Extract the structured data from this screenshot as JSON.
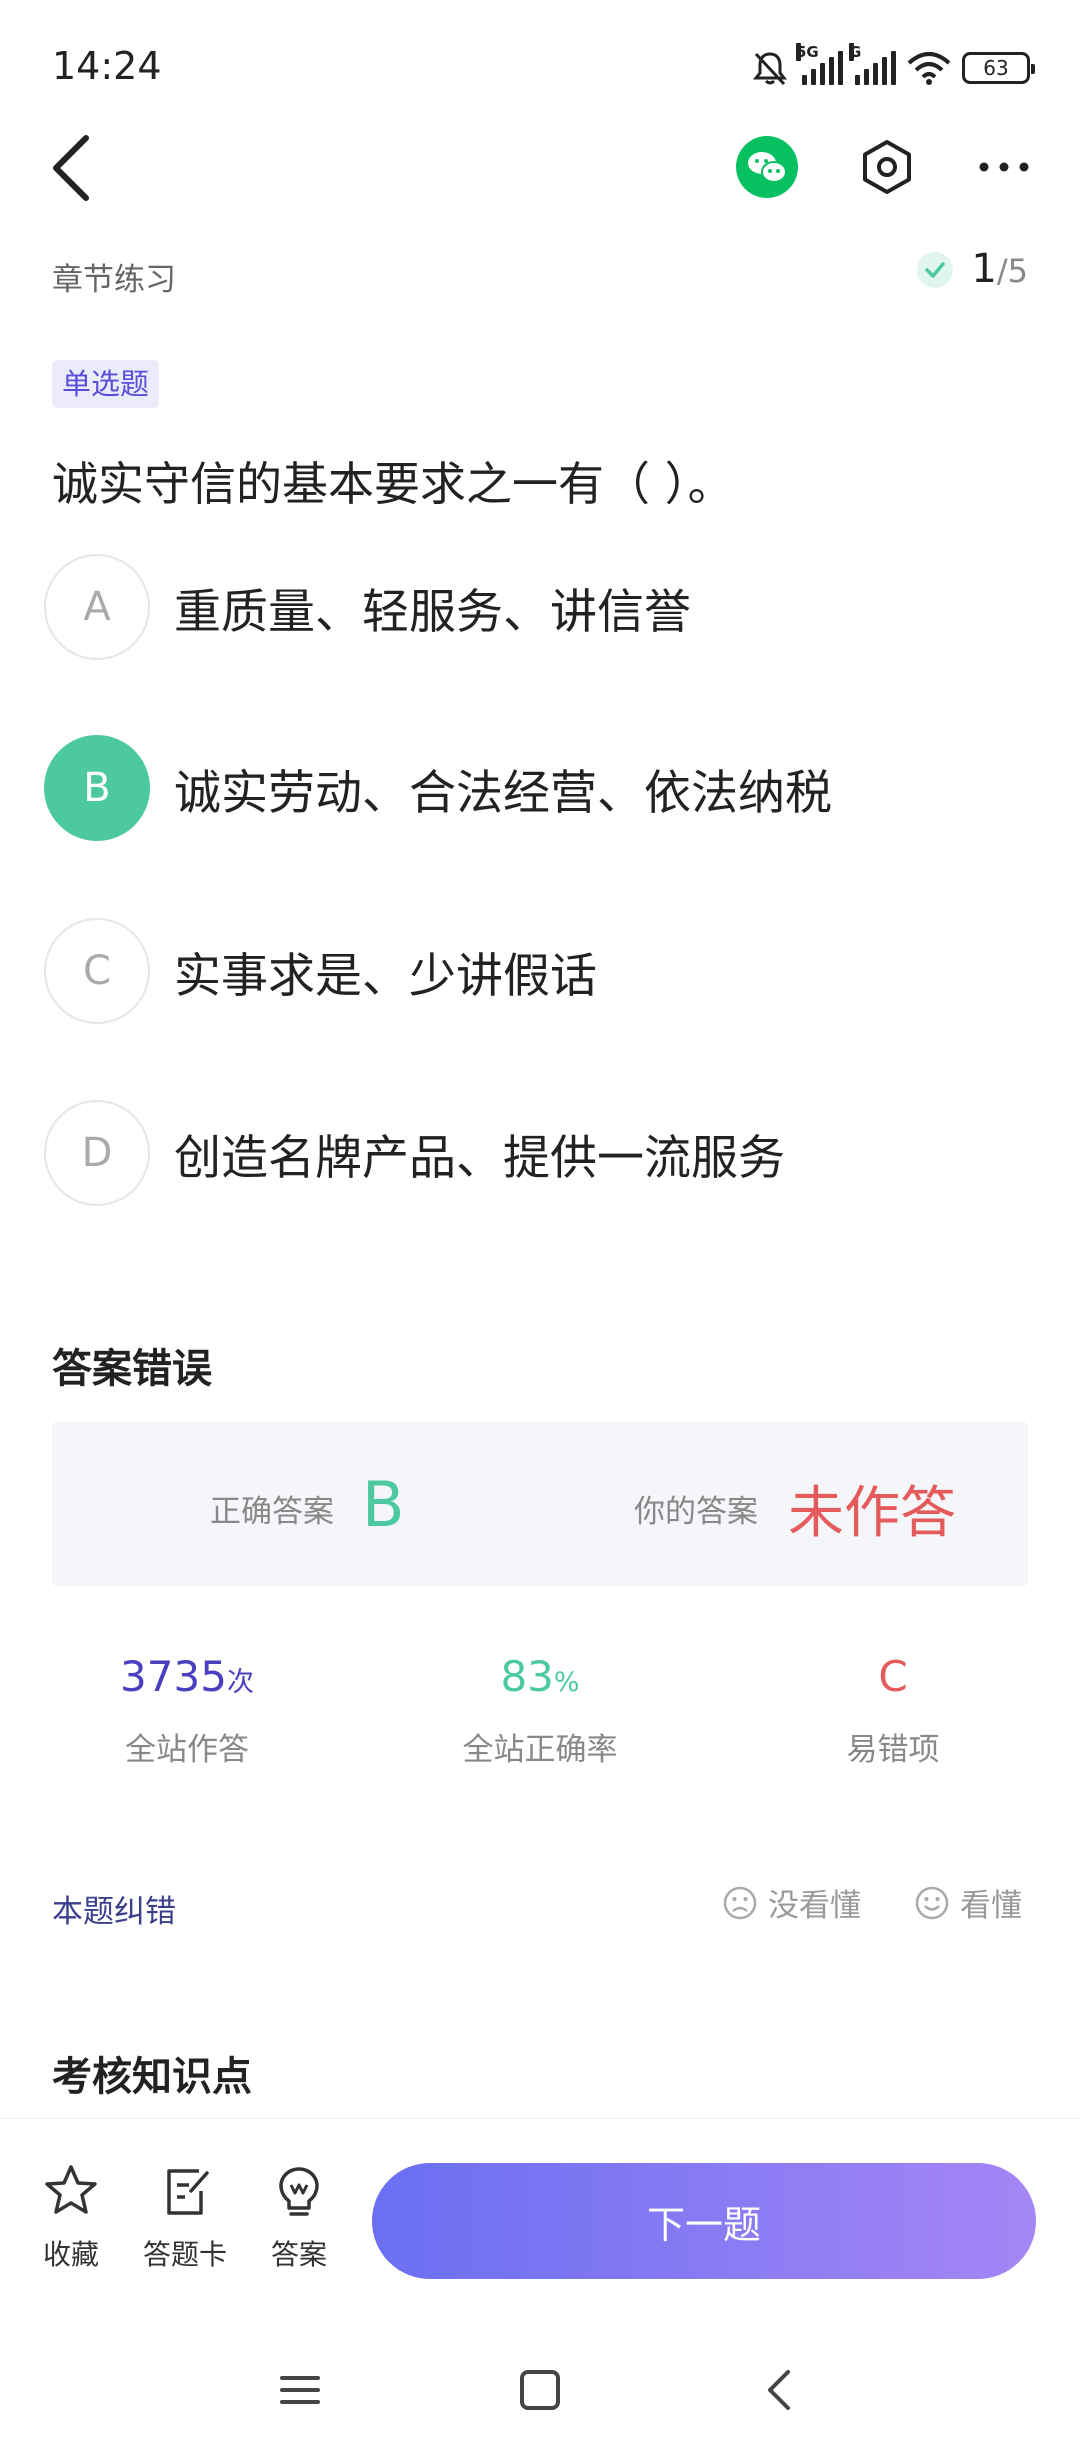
{
  "status_bar": {
    "time": "14:24",
    "signal1_tag": "5G",
    "signal2_tag": "G",
    "battery": "63",
    "icons": [
      "bell-off-icon",
      "signal-icon",
      "wifi-icon",
      "battery-icon"
    ]
  },
  "header": {
    "icons": [
      "back-icon",
      "wechat-icon",
      "settings-icon",
      "more-icon"
    ],
    "section": "章节练习",
    "progress": {
      "current": "1",
      "separator": "/",
      "total": "5"
    }
  },
  "question": {
    "type": "单选题",
    "text": "诚实守信的基本要求之一有（ ）。",
    "options": [
      {
        "letter": "A",
        "text": "重质量、轻服务、讲信誉"
      },
      {
        "letter": "B",
        "text": "诚实劳动、合法经营、依法纳税"
      },
      {
        "letter": "C",
        "text": "实事求是、少讲假话"
      },
      {
        "letter": "D",
        "text": "创造名牌产品、提供一流服务"
      }
    ],
    "highlighted_option": "B"
  },
  "result": {
    "title": "答案错误",
    "correct_label": "正确答案",
    "correct_value": "B",
    "yours_label": "你的答案",
    "yours_value": "未作答"
  },
  "stats": [
    {
      "value": "3735",
      "unit": "次",
      "label": "全站作答",
      "color": "#4a3fbf"
    },
    {
      "value": "83",
      "unit": "%",
      "label": "全站正确率",
      "color": "#4cc9a0"
    },
    {
      "value": "C",
      "unit": "",
      "label": "易错项",
      "color": "#e55a5a"
    }
  ],
  "feedback": {
    "report": "本题纠错",
    "not_understood": "没看懂",
    "understood": "看懂"
  },
  "knowledge_title": "考核知识点",
  "bottom": {
    "favorite": "收藏",
    "answer_card": "答题卡",
    "answer": "答案",
    "next": "下一题"
  },
  "nav": [
    "menu-icon",
    "home-icon",
    "back-icon"
  ],
  "colors": {
    "accent_green": "#4cc9a0",
    "accent_purple": "#6a6ff2",
    "error_red": "#e55a5a",
    "badge_bg": "#ecebfb"
  }
}
